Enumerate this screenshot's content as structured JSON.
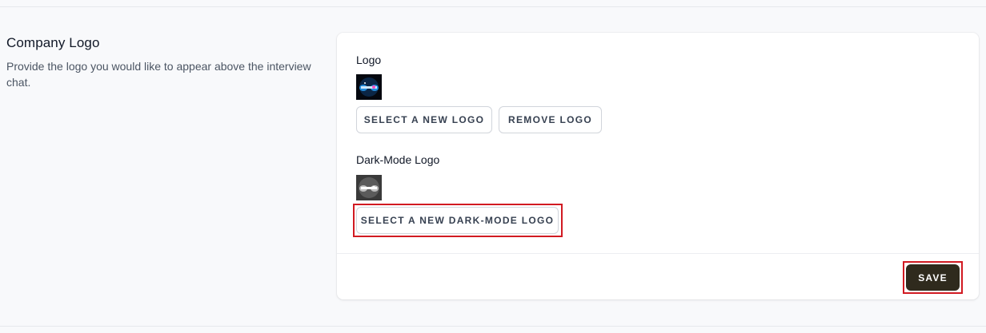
{
  "section": {
    "title": "Company Logo",
    "description": "Provide the logo you would like to appear above the interview chat."
  },
  "logo": {
    "label": "Logo",
    "select_button": "SELECT A NEW LOGO",
    "remove_button": "REMOVE LOGO"
  },
  "dark_logo": {
    "label": "Dark-Mode Logo",
    "select_button": "SELECT A NEW DARK-MODE LOGO"
  },
  "footer": {
    "save_button": "SAVE"
  },
  "colors": {
    "save_bg": "#2f2a1d",
    "highlight": "#d11a22",
    "page_bg": "#f8f9fb"
  }
}
